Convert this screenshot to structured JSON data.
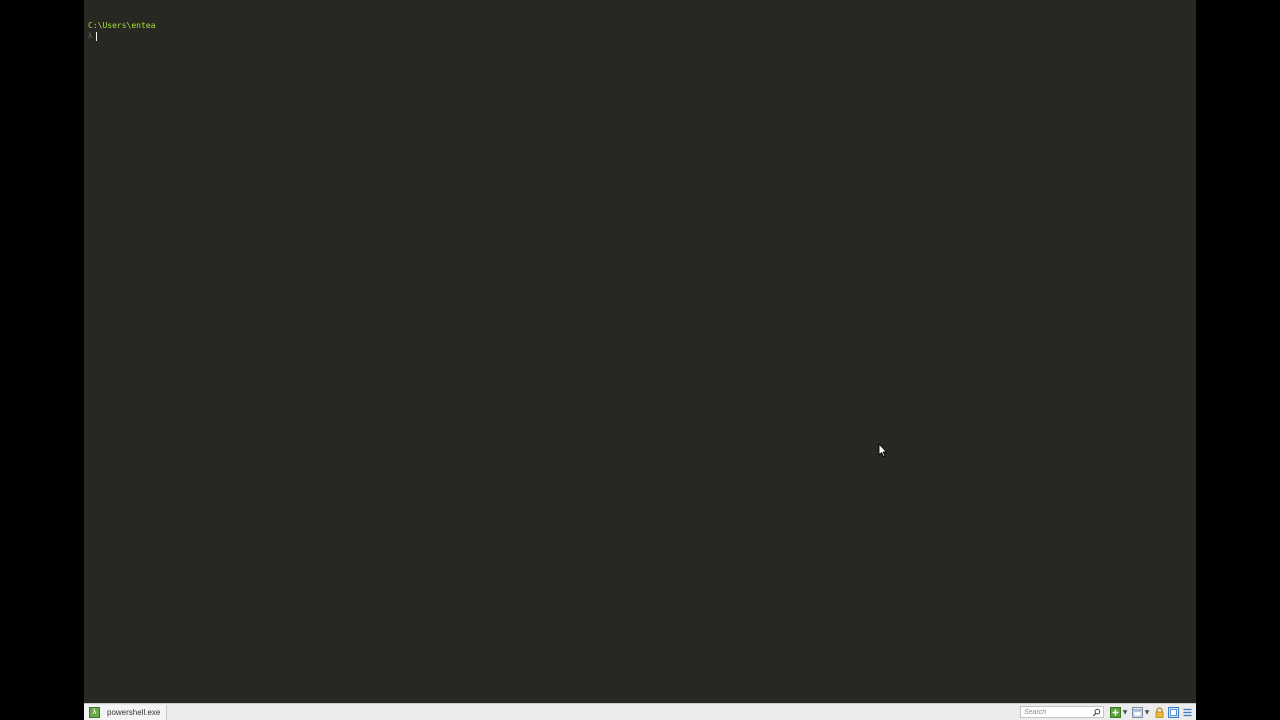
{
  "terminal": {
    "cwd": "C:\\Users\\entea",
    "prompt_symbol": "λ",
    "input": ""
  },
  "statusbar": {
    "tab_label": "powershell.exe",
    "search_placeholder": "Search",
    "icons": [
      "search-icon",
      "new-console-icon",
      "split-view-icon",
      "lock-icon",
      "maximize-icon",
      "menu-icon"
    ]
  },
  "colors": {
    "terminal_bg": "#272822",
    "cwd_text": "#a6e22e",
    "statusbar_bg": "#ececec",
    "tab_icon": "#6aa84f"
  }
}
